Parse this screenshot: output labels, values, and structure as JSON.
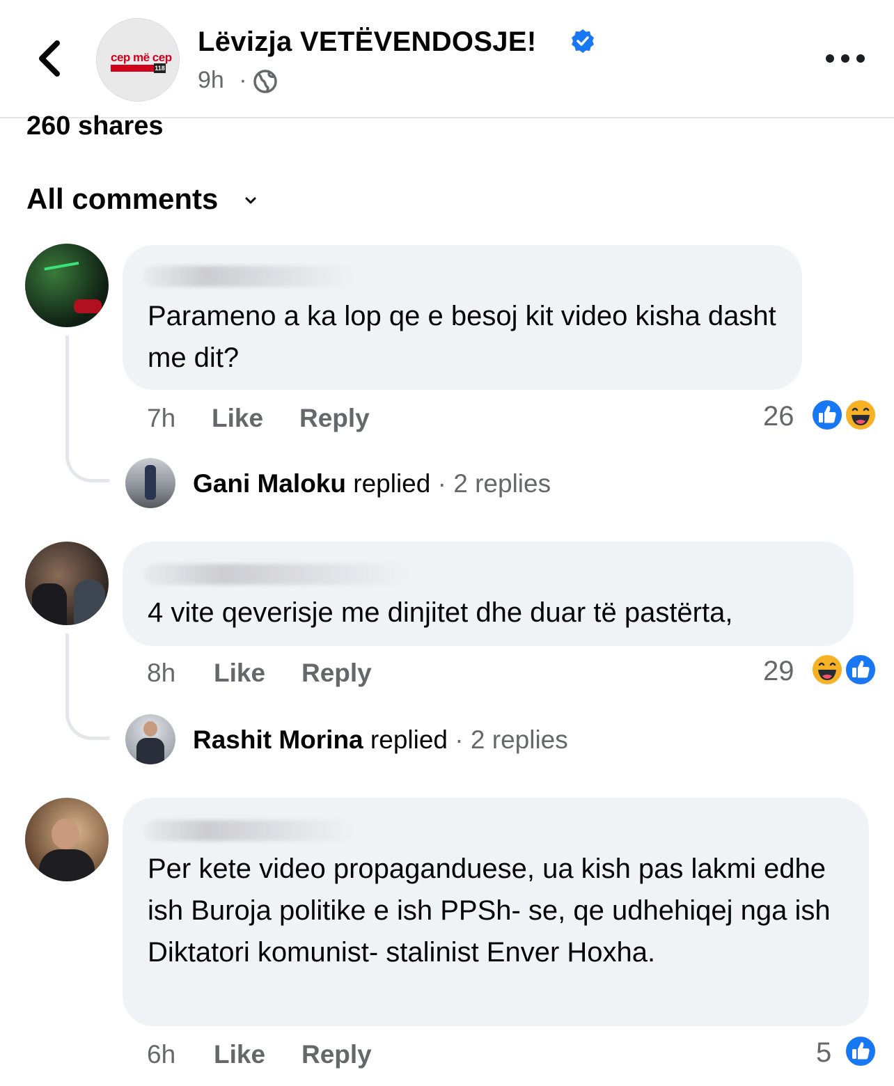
{
  "header": {
    "page_name": "Lëvizja VETËVENDOSJE!",
    "time": "9h",
    "separator": "·",
    "avatar_logo_top": "cep më cep",
    "avatar_logo_badge": "118",
    "icons": {
      "back": "chevron-left-icon",
      "verified": "verified-badge-icon",
      "audience": "globe-icon",
      "more": "more-dots-icon"
    }
  },
  "post": {
    "shares": "260 shares",
    "sort_label": "All comments"
  },
  "comments": [
    {
      "author": "Arber Maloku",
      "text": "Parameno a ka lop qe e besoj kit video kisha dasht me dit?",
      "time": "7h",
      "like": "Like",
      "reply": "Reply",
      "reaction_count": "26",
      "reactions": [
        "like",
        "haha"
      ],
      "replies": {
        "name": "Gani Maloku",
        "verb": "replied",
        "sep": "·",
        "count": "2 replies"
      }
    },
    {
      "author": "",
      "text": "4 vite qeverisje me dinjitet dhe duar të pastërta,",
      "time": "8h",
      "like": "Like",
      "reply": "Reply",
      "reaction_count": "29",
      "reactions": [
        "haha",
        "like"
      ],
      "replies": {
        "name": "Rashit Morina",
        "verb": "replied",
        "sep": "·",
        "count": "2 replies"
      }
    },
    {
      "author": "",
      "text": "Per kete video propaganduese, ua kish pas lakmi edhe ish Buroja politike e ish PPSh- se, qe udhehiqej nga ish Diktatori komunist- stalinist Enver Hoxha.",
      "time": "6h",
      "like": "Like",
      "reply": "Reply",
      "reaction_count": "5",
      "reactions": [
        "like"
      ]
    }
  ],
  "colors": {
    "like_blue": "#1877f2",
    "haha_yellow": "#f7b125",
    "bubble_bg": "#f0f2f5",
    "meta_gray": "#65676b"
  }
}
